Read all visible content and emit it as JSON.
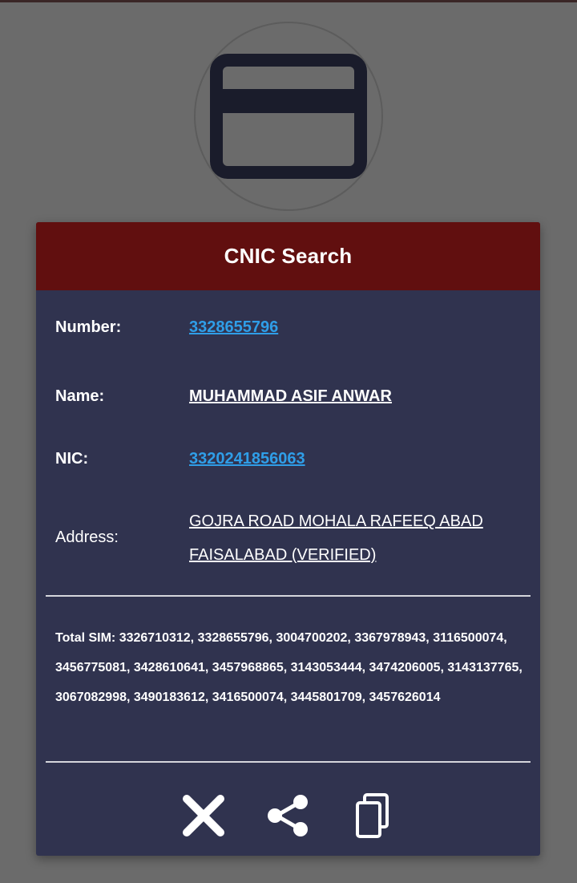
{
  "icons": {
    "hero": "credit-card-icon",
    "close": "close-icon",
    "share": "share-icon",
    "copy": "copy-icon"
  },
  "colors": {
    "backdrop": "#6b6b6b",
    "header": "#610f0f",
    "panel": "#30334f",
    "link": "#2f9ee8"
  },
  "dialog": {
    "title": "CNIC Search",
    "number": {
      "label": "Number:",
      "value": "3328655796"
    },
    "name": {
      "label": "Name:",
      "value": "MUHAMMAD ASIF ANWAR"
    },
    "nic": {
      "label": "NIC:",
      "value": "3320241856063"
    },
    "address": {
      "label": "Address:",
      "value": "GOJRA ROAD MOHALA RAFEEQ ABAD FAISALABAD (VERIFIED)"
    },
    "total_sim": "Total SIM: 3326710312, 3328655796, 3004700202, 3367978943, 3116500074, 3456775081, 3428610641, 3457968865, 3143053444, 3474206005, 3143137765, 3067082998, 3490183612, 3416500074, 3445801709, 3457626014"
  }
}
